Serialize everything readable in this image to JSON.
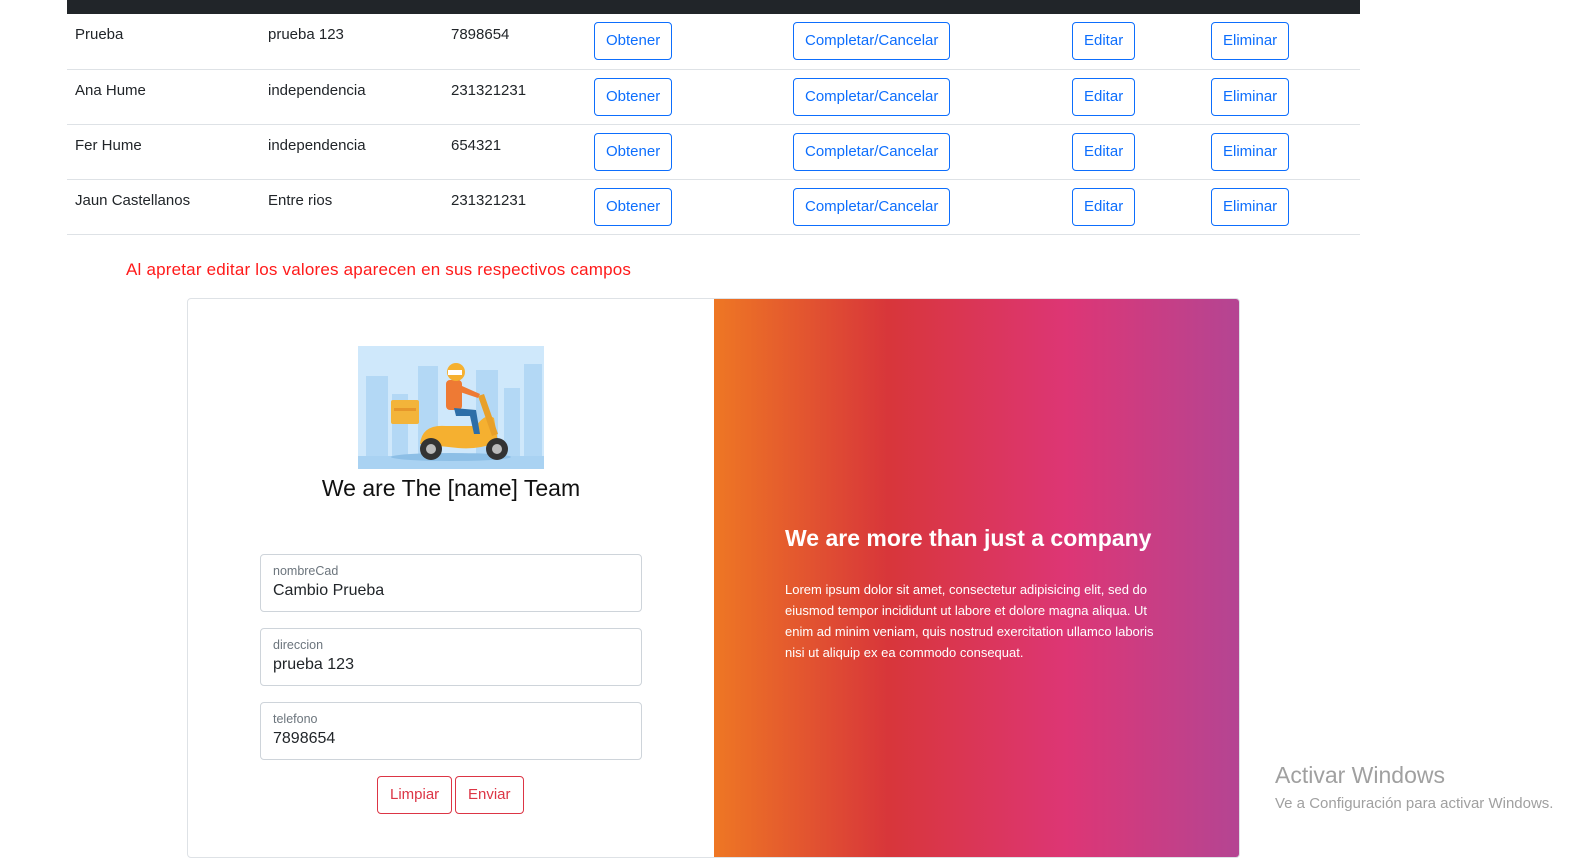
{
  "table": {
    "rows": [
      {
        "nombre": "Prueba",
        "direccion": "prueba 123",
        "telefono": "7898654"
      },
      {
        "nombre": "Ana Hume",
        "direccion": "independencia",
        "telefono": "231321231"
      },
      {
        "nombre": "Fer Hume",
        "direccion": "independencia",
        "telefono": "654321"
      },
      {
        "nombre": "Jaun Castellanos",
        "direccion": "Entre rios",
        "telefono": "231321231"
      }
    ],
    "actions": {
      "obtener": "Obtener",
      "completar": "Completar/Cancelar",
      "editar": "Editar",
      "eliminar": "Eliminar"
    }
  },
  "note": "Al apretar editar los valores aparecen en sus respectivos campos",
  "form": {
    "team_title": "We are The [name] Team",
    "fields": {
      "nombre": {
        "label": "nombreCad",
        "value": "Cambio Prueba"
      },
      "direccion": {
        "label": "direccion",
        "value": "prueba 123"
      },
      "telefono": {
        "label": "telefono",
        "value": "7898654"
      }
    },
    "limpiar": "Limpiar",
    "enviar": "Enviar"
  },
  "hero": {
    "title": "We are more than just a company",
    "text": "Lorem ipsum dolor sit amet, consectetur adipisicing elit, sed do eiusmod tempor incididunt ut labore et dolore magna aliqua. Ut enim ad minim veniam, quis nostrud exercitation ullamco laboris nisi ut aliquip ex ea commodo consequat."
  },
  "watermark": {
    "line1": "Activar Windows",
    "line2": "Ve a Configuración para activar Windows."
  },
  "colors": {
    "primary": "#0d6efd",
    "danger": "#dc3545",
    "note": "#ff1a1a",
    "gradient": [
      "#ee7724",
      "#d8363a",
      "#dd3675",
      "#b44593"
    ]
  }
}
